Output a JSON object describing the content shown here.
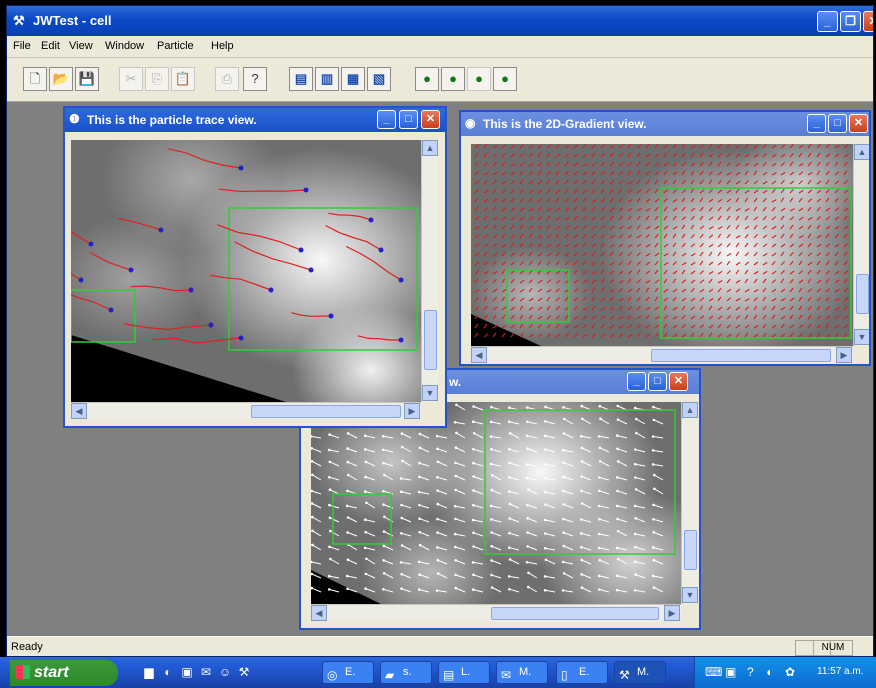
{
  "window": {
    "title": "JWTest - cell",
    "app_icon": "tools-icon"
  },
  "menu": [
    "File",
    "Edit",
    "View",
    "Window",
    "Particle",
    "Help"
  ],
  "toolbar": {
    "buttons": [
      {
        "icon": "new-document-icon",
        "glyph": "🗋",
        "enabled": true
      },
      {
        "icon": "open-folder-icon",
        "glyph": "📂",
        "enabled": true
      },
      {
        "icon": "save-icon",
        "glyph": "💾",
        "enabled": true
      },
      {
        "icon": "cut-icon",
        "glyph": "✂",
        "enabled": false
      },
      {
        "icon": "copy-icon",
        "glyph": "⎘",
        "enabled": false
      },
      {
        "icon": "paste-icon",
        "glyph": "📋",
        "enabled": false
      },
      {
        "icon": "print-icon",
        "glyph": "⎙",
        "enabled": false
      },
      {
        "icon": "help-icon",
        "glyph": "?",
        "enabled": true
      },
      {
        "icon": "trace-view-icon",
        "glyph": "▤",
        "enabled": true
      },
      {
        "icon": "gradient-view-icon",
        "glyph": "▥",
        "enabled": true
      },
      {
        "icon": "vector-view-icon",
        "glyph": "▦",
        "enabled": true
      },
      {
        "icon": "grid-view-icon",
        "glyph": "▧",
        "enabled": true
      },
      {
        "icon": "particle-run-icon",
        "glyph": "●",
        "enabled": true
      },
      {
        "icon": "particle-step-icon",
        "glyph": "●",
        "enabled": true
      },
      {
        "icon": "particle-pause-icon",
        "glyph": "●",
        "enabled": false
      },
      {
        "icon": "particle-stop-icon",
        "glyph": "●",
        "enabled": true
      }
    ]
  },
  "windows": {
    "trace": {
      "title": "This is the particle trace view.",
      "active": true
    },
    "gradient": {
      "title": "This is the 2D-Gradient view.",
      "active": false
    },
    "vector": {
      "title": "w.",
      "active": false
    }
  },
  "status": {
    "text": "Ready",
    "num": "NUM"
  },
  "taskbar": {
    "start_label": "start",
    "items": [
      {
        "label": "E.",
        "icon": "browser-icon"
      },
      {
        "label": "s.",
        "icon": "folder-icon"
      },
      {
        "label": "L.",
        "icon": "terminal-icon"
      },
      {
        "label": "M.",
        "icon": "mail-icon"
      },
      {
        "label": "E.",
        "icon": "document-icon"
      },
      {
        "label": "M.",
        "icon": "tools-icon"
      }
    ],
    "clock": "11:57 a.m."
  }
}
